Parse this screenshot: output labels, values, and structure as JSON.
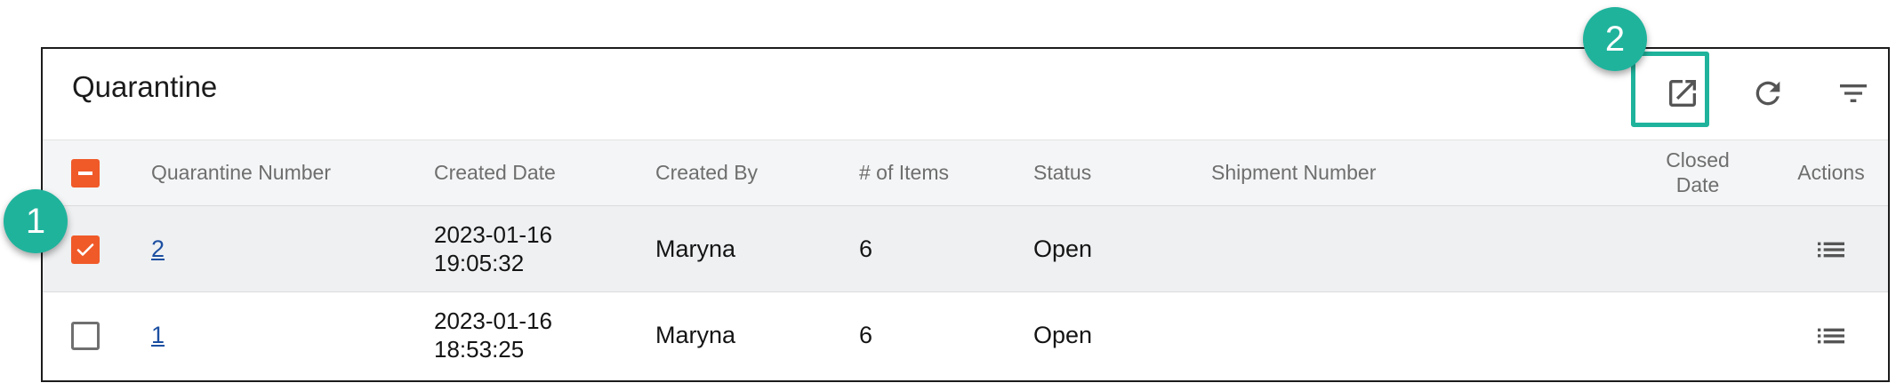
{
  "panel": {
    "title": "Quarantine",
    "toolbar": {
      "export_icon": "open-in-new-icon",
      "refresh_icon": "refresh-icon",
      "filter_icon": "filter-icon"
    }
  },
  "table": {
    "header_checkbox_state": "indeterminate",
    "columns": {
      "quarantine_number": "Quarantine Number",
      "created_date": "Created Date",
      "created_by": "Created By",
      "num_items": "# of Items",
      "status": "Status",
      "shipment_number": "Shipment Number",
      "closed_date": "Closed Date",
      "actions": "Actions"
    },
    "rows": [
      {
        "selected": true,
        "quarantine_number": "2",
        "created_date_day": "2023-01-16",
        "created_date_time": "19:05:32",
        "created_by": "Maryna",
        "num_items": "6",
        "status": "Open",
        "shipment_number": "",
        "closed_date": "",
        "actions_icon": "list-icon"
      },
      {
        "selected": false,
        "quarantine_number": "1",
        "created_date_day": "2023-01-16",
        "created_date_time": "18:53:25",
        "created_by": "Maryna",
        "num_items": "6",
        "status": "Open",
        "shipment_number": "",
        "closed_date": "",
        "actions_icon": "list-icon"
      }
    ]
  },
  "annotations": {
    "step_1": "1",
    "step_2": "2"
  },
  "colors": {
    "accent_orange": "#f05a28",
    "annotation_teal": "#1fb39c",
    "link_blue": "#1c4fa1",
    "header_bg": "#f4f5f6",
    "selected_row_bg": "#eef0f2"
  }
}
